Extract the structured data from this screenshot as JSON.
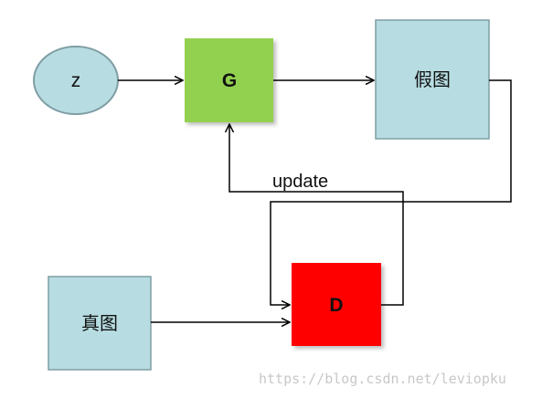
{
  "colors": {
    "generator": "#92d050",
    "discriminator": "#ff0000",
    "image_box": "#b7dde2",
    "noise_node": "#b7dde2",
    "box_border": "#7f9ea4",
    "arrow": "#000000"
  },
  "nodes": {
    "noise": {
      "label": "z"
    },
    "generator": {
      "label": "G"
    },
    "fake_image": {
      "label": "假图"
    },
    "real_image": {
      "label": "真图"
    },
    "discriminator": {
      "label": "D"
    }
  },
  "edges": {
    "update_label": "update"
  },
  "watermark": {
    "text": "https://blog.csdn.net/leviopku"
  }
}
